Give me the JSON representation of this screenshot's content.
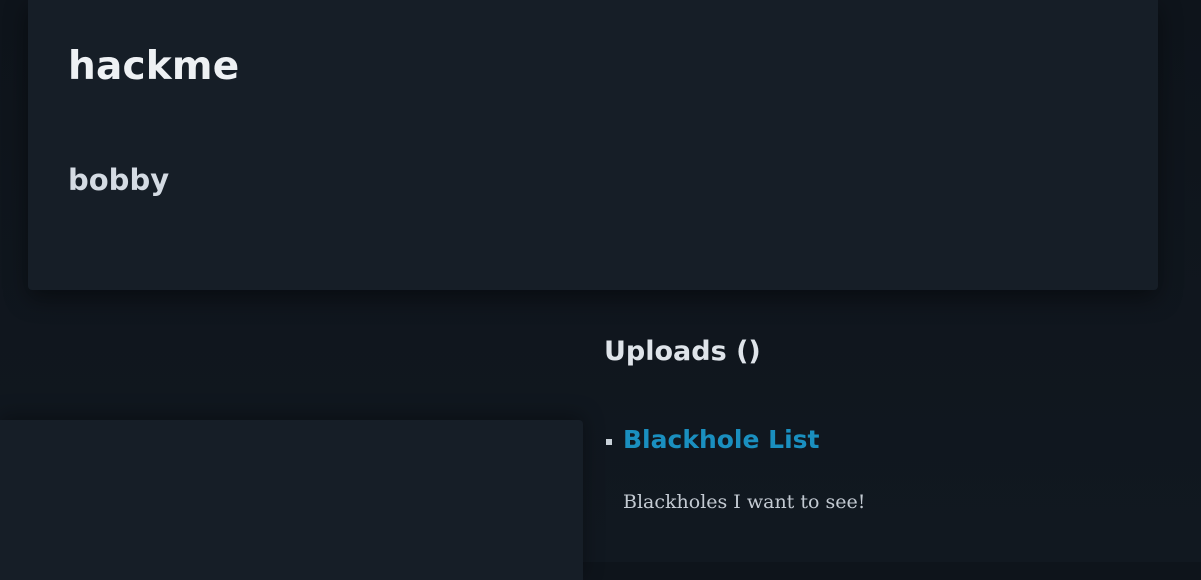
{
  "header": {
    "site_title": "hackme",
    "username": "bobby"
  },
  "uploads": {
    "heading": "Uploads ()",
    "items": [
      {
        "title": "Blackhole List",
        "description": "Blackholes I want to see!"
      }
    ]
  },
  "colors": {
    "background": "#0e141b",
    "card": "#161e27",
    "link": "#1a8fbf",
    "text": "#dfe4ea"
  }
}
